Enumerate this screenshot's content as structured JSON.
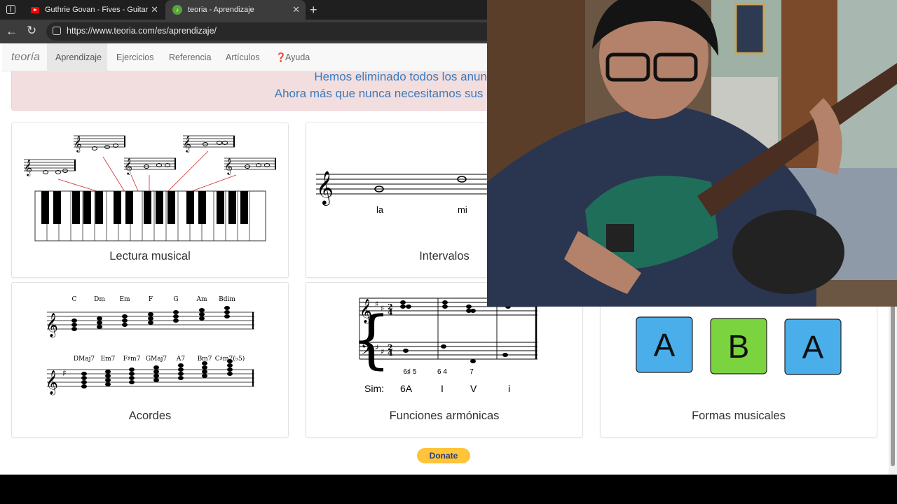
{
  "browser": {
    "tabs": [
      {
        "title": "Guthrie Govan - Fives - Guitar per",
        "icon": "youtube-icon"
      },
      {
        "title": "teoria - Aprendizaje",
        "icon": "teoria-icon"
      }
    ],
    "url": "https://www.teoria.com/es/aprendizaje/"
  },
  "nav": {
    "brand": "teoría",
    "items": [
      "Aprendizaje",
      "Ejercicios",
      "Referencia",
      "Artículos",
      "Ayuda"
    ]
  },
  "banner": {
    "line1": "Hemos eliminado todos los anuncios publicitarios",
    "line2": "Ahora más que nunca necesitamos sus donaciones. ¡Ayúdenos!"
  },
  "cards": [
    {
      "label": "Lectura musical"
    },
    {
      "label": "Intervalos",
      "notes": [
        "la",
        "mi"
      ]
    },
    {
      "label": "Acordes",
      "chords_row1": [
        "C",
        "Dm",
        "Em",
        "F",
        "G",
        "Am",
        "Bdim"
      ],
      "chords_row2": [
        "DMaj7",
        "Em7",
        "F♯m7",
        "GMaj7",
        "A7",
        "Bm7",
        "C♯m7(♭5)"
      ]
    },
    {
      "label": "Funciones armónicas",
      "figures": [
        "6♯ 5",
        "6 4",
        "7"
      ],
      "roman_prefix": "Sim:",
      "roman": [
        "6A",
        "I",
        "V",
        "i"
      ]
    },
    {
      "label": "Formas musicales",
      "blocks": [
        "A",
        "B",
        "A"
      ]
    }
  ],
  "donate_button": "Donate",
  "colors": {
    "block_blue": "#4aaeea",
    "block_green": "#7bd33f",
    "banner_text": "#3a7bbf",
    "donate_yellow": "#ffc439"
  }
}
